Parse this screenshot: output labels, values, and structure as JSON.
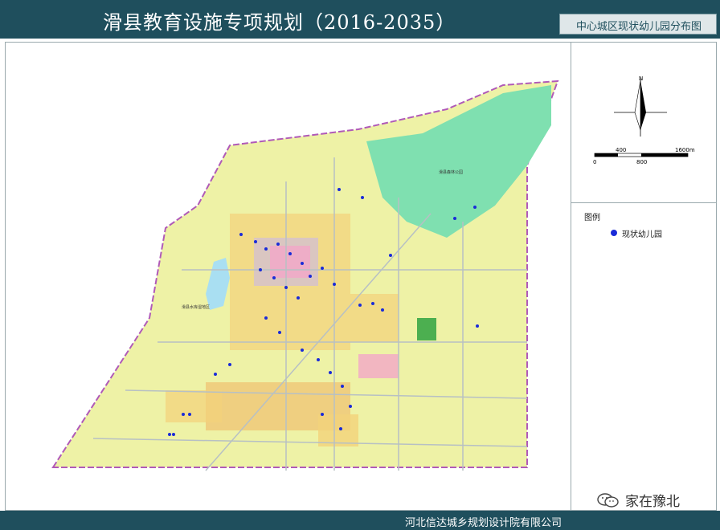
{
  "header": {
    "title": "滑县教育设施专项规划（2016-2035）",
    "subtitle": "中心城区现状幼儿园分布图"
  },
  "footer": {
    "organization": "河北信达城乡规划设计院有限公司"
  },
  "watermark": {
    "text": "家在豫北",
    "icon": "wechat-icon"
  },
  "compass": {
    "north_label": "N"
  },
  "scale": {
    "top_labels": [
      "400",
      "1600m"
    ],
    "bottom_labels": [
      "0",
      "800"
    ]
  },
  "legend": {
    "title": "图例",
    "items": [
      {
        "label": "现状幼儿园",
        "color": "#1a2bd8"
      }
    ]
  },
  "map_labels": {
    "forest_park": "滑县森林公园",
    "wetland": "滑县水库湿地区"
  },
  "colors": {
    "header_bg": "#1f4f5d",
    "base_land": "#eef2a6",
    "forest": "#7fe0b0",
    "residential": "#f3d27a",
    "commercial": "#f2a6c8",
    "kindergarten": "#1a2bd8",
    "boundary": "#b05ab8"
  }
}
